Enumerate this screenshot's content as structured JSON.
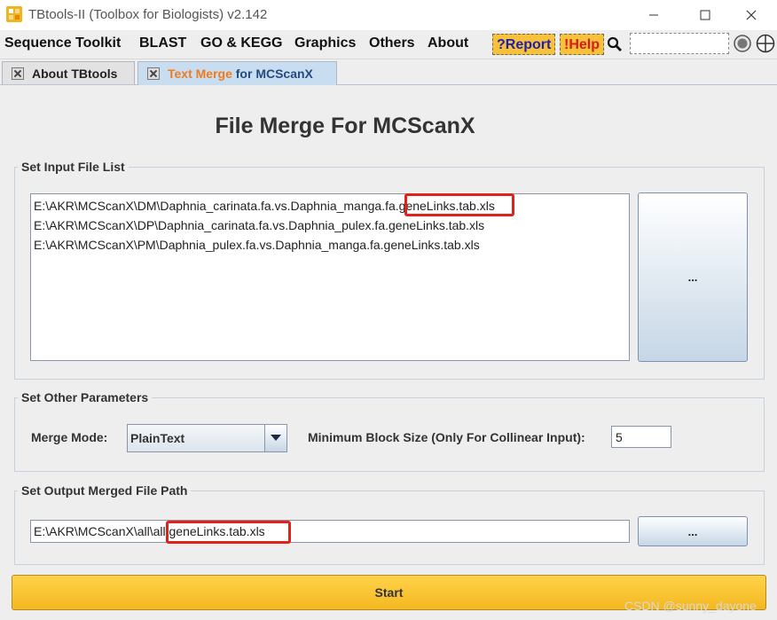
{
  "window": {
    "title": "TBtools-II (Toolbox for Biologists) v2.142"
  },
  "menu": {
    "items": [
      "Sequence Toolkit",
      "BLAST",
      "GO & KEGG",
      "Graphics",
      "Others",
      "About"
    ],
    "report_label": "?Report",
    "help_label": "!Help",
    "search_value": ""
  },
  "tabs": [
    {
      "label": "About TBtools"
    },
    {
      "label_highlight": "Text Merge",
      "label_rest": " for MCScanX"
    }
  ],
  "page": {
    "heading": "File Merge For MCScanX",
    "input_group": {
      "title": "Set Input File List",
      "files": [
        "E:\\AKR\\MCScanX\\DM\\Daphnia_carinata.fa.vs.Daphnia_manga.fa.geneLinks.tab.xls",
        "E:\\AKR\\MCScanX\\DP\\Daphnia_carinata.fa.vs.Daphnia_pulex.fa.geneLinks.tab.xls",
        "E:\\AKR\\MCScanX\\PM\\Daphnia_pulex.fa.vs.Daphnia_manga.fa.geneLinks.tab.xls"
      ],
      "browse_label": "..."
    },
    "params_group": {
      "title": "Set Other Parameters",
      "merge_mode_label": "Merge Mode:",
      "merge_mode_value": "PlainText",
      "min_block_label": "Minimum Block Size (Only For Collinear Input):",
      "min_block_value": "5"
    },
    "output_group": {
      "title": "Set Output Merged File Path",
      "path_value": "E:\\AKR\\MCScanX\\all\\all.geneLinks.tab.xls",
      "browse_label": "..."
    },
    "start_label": "Start"
  },
  "watermark": "CSDN @sunny_dayone",
  "colors": {
    "highlight_red": "#e0221b",
    "accent_orange": "#f07b1e",
    "menu_button_yellow": "#f7c23a",
    "start_yellow": "#f8c43c"
  }
}
